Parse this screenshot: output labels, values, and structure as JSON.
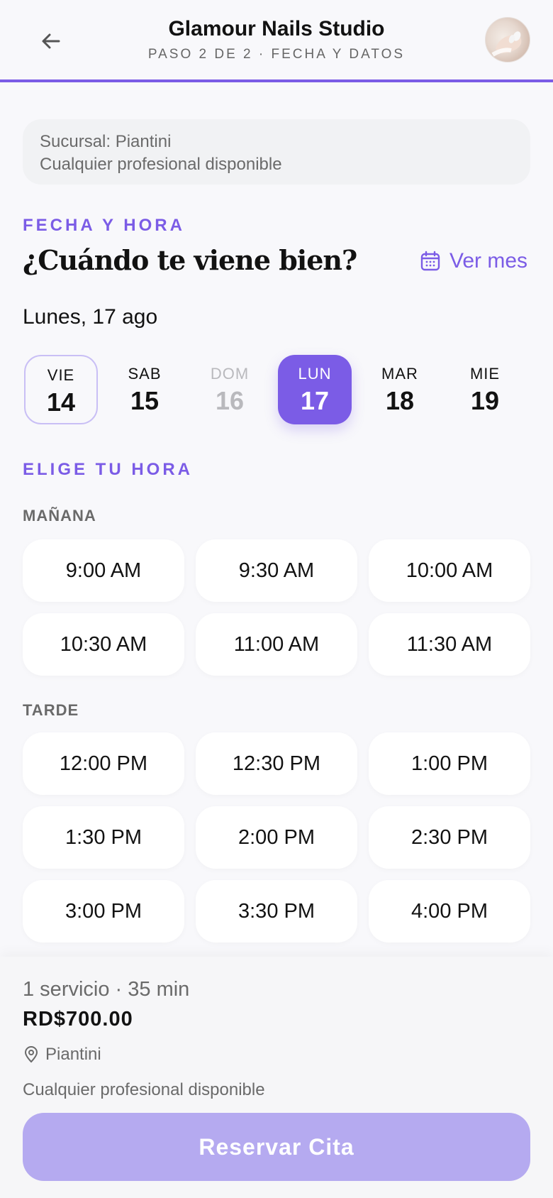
{
  "header": {
    "title": "Glamour Nails Studio",
    "subtitle": "PASO 2 DE 2 · FECHA Y DATOS",
    "back_icon": "arrow-left-icon"
  },
  "info_card": {
    "branch": "Sucursal: Piantini",
    "professional": "Cualquier profesional disponible"
  },
  "date_section": {
    "eyebrow": "FECHA Y HORA",
    "title": "¿Cuándo te viene bien?",
    "see_month": "Ver mes",
    "selected_date_label": "Lunes, 17 ago",
    "days": [
      {
        "name": "VIE",
        "num": "14",
        "state": "today"
      },
      {
        "name": "SAB",
        "num": "15",
        "state": "normal"
      },
      {
        "name": "DOM",
        "num": "16",
        "state": "disabled"
      },
      {
        "name": "LUN",
        "num": "17",
        "state": "selected"
      },
      {
        "name": "MAR",
        "num": "18",
        "state": "normal"
      },
      {
        "name": "MIE",
        "num": "19",
        "state": "normal"
      }
    ]
  },
  "time_section": {
    "eyebrow": "ELIGE TU HORA",
    "morning_label": "MAÑANA",
    "morning": [
      "9:00 AM",
      "9:30 AM",
      "10:00 AM",
      "10:30 AM",
      "11:00 AM",
      "11:30 AM"
    ],
    "afternoon_label": "TARDE",
    "afternoon": [
      "12:00 PM",
      "12:30 PM",
      "1:00 PM",
      "1:30 PM",
      "2:00 PM",
      "2:30 PM",
      "3:00 PM",
      "3:30 PM",
      "4:00 PM"
    ]
  },
  "summary": {
    "services": "1 servicio · 35 min",
    "price": "RD$700.00",
    "location": "Piantini",
    "professional": "Cualquier profesional disponible",
    "reserve_label": "Reservar Cita"
  },
  "colors": {
    "accent": "#7b5ce6",
    "accent_disabled": "#b5aaf0"
  }
}
